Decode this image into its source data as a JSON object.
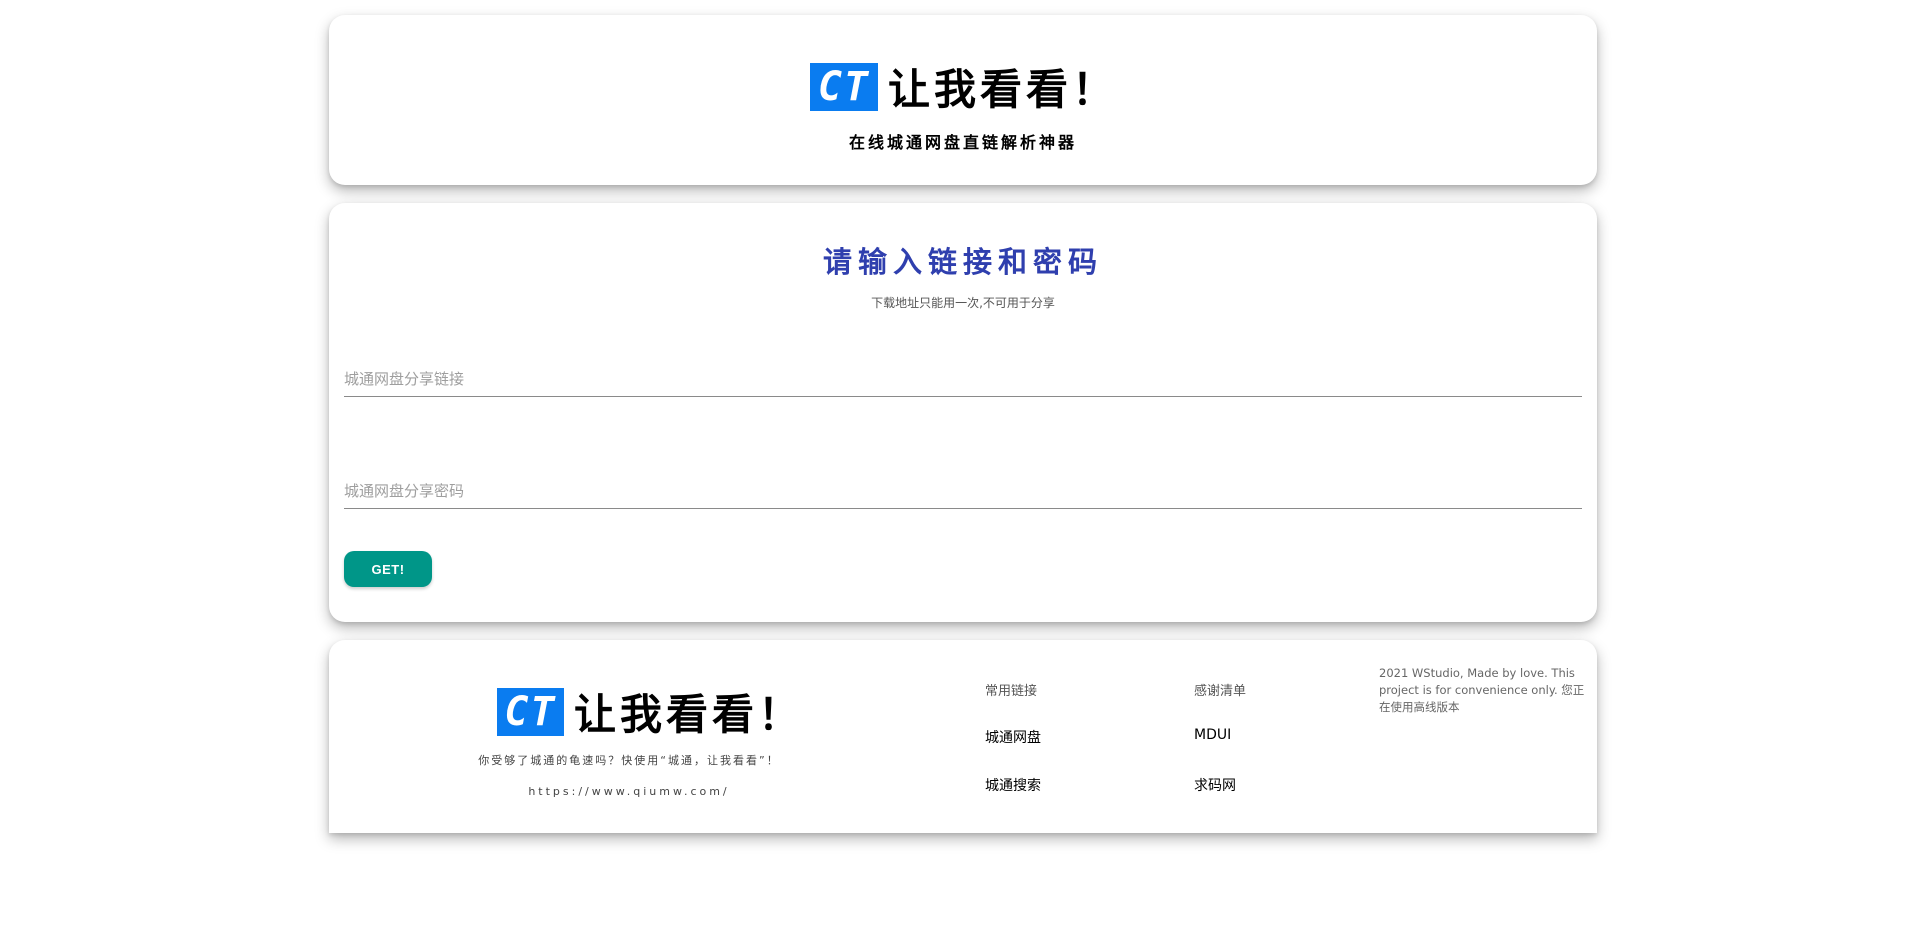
{
  "header": {
    "logo_ct": "CT",
    "logo_name": "让我看看！",
    "subtitle": "在线城通网盘直链解析神器"
  },
  "form": {
    "title": "请输入链接和密码",
    "note": "下载地址只能用一次,不可用于分享",
    "link_placeholder": "城通网盘分享链接",
    "link_value": "",
    "password_placeholder": "城通网盘分享密码",
    "password_value": "",
    "submit_label": "GET!"
  },
  "footer": {
    "logo_ct": "CT",
    "logo_name": "让我看看！",
    "tagline": "你受够了城通的龟速吗？快使用“城通，让我看看”！",
    "url": "https://www.qiumw.com/",
    "columns": [
      {
        "heading": "常用链接",
        "links": [
          "城通网盘",
          "城通搜索"
        ]
      },
      {
        "heading": "感谢清单",
        "links": [
          "MDUI",
          "求码网"
        ]
      }
    ],
    "copyright": "2021 WStudio, Made by love. This project is for convenience only. 您正在使用高线版本"
  },
  "colors": {
    "logo_blue": "#0a7cf0",
    "title_indigo": "#2f3fae",
    "button_teal": "#009688"
  }
}
